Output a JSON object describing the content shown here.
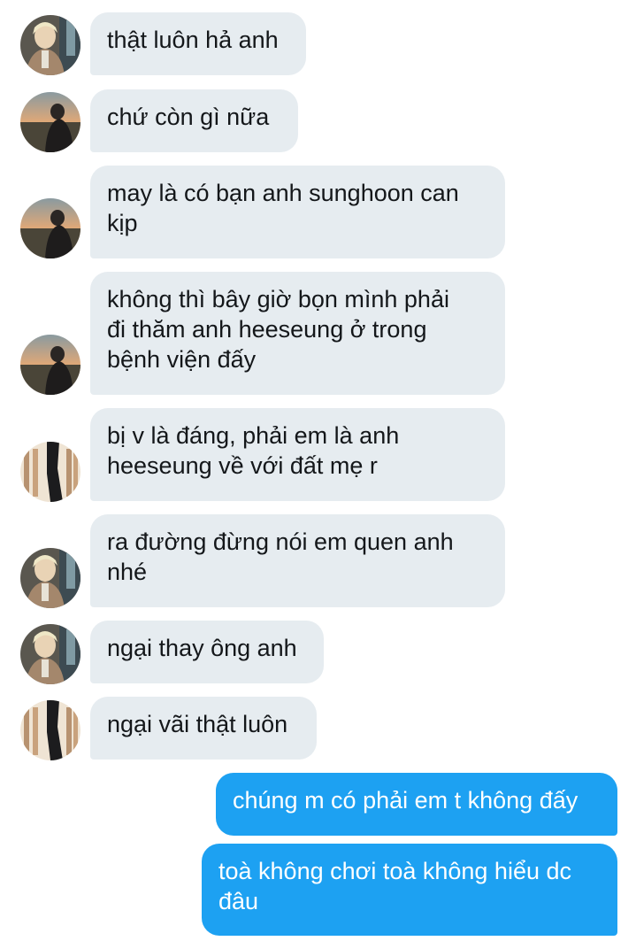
{
  "messages": [
    {
      "direction": "in",
      "avatar": "avatar-a",
      "lines": [
        "thật luôn hả anh"
      ]
    },
    {
      "direction": "in",
      "avatar": "avatar-b",
      "lines": [
        "chứ còn gì nữa"
      ]
    },
    {
      "direction": "in",
      "avatar": "avatar-b",
      "lines": [
        "may là có bạn anh sunghoon can",
        "kịp"
      ]
    },
    {
      "direction": "in",
      "avatar": "avatar-b",
      "lines": [
        "không thì bây giờ bọn mình phải",
        "đi thăm anh heeseung ở trong",
        "bệnh viện đấy"
      ]
    },
    {
      "direction": "in",
      "avatar": "avatar-c",
      "lines": [
        "bị v là đáng, phải em là anh",
        "heeseung về với đất mẹ r"
      ]
    },
    {
      "direction": "in",
      "avatar": "avatar-a",
      "lines": [
        "ra đường đừng nói em quen anh",
        "nhé"
      ]
    },
    {
      "direction": "in",
      "avatar": "avatar-a",
      "lines": [
        "ngại thay ông anh"
      ]
    },
    {
      "direction": "in",
      "avatar": "avatar-c",
      "lines": [
        "ngại vãi thật luôn"
      ]
    },
    {
      "direction": "out",
      "lines": [
        "chúng m có phải em t không đấy"
      ]
    },
    {
      "direction": "out",
      "lines": [
        "toà không chơi toà không hiểu dc",
        "đâu"
      ]
    }
  ],
  "colors": {
    "incoming_bubble": "#e6ecf0",
    "incoming_text": "#14171a",
    "outgoing_bubble": "#1da1f2",
    "outgoing_text": "#ffffff"
  }
}
